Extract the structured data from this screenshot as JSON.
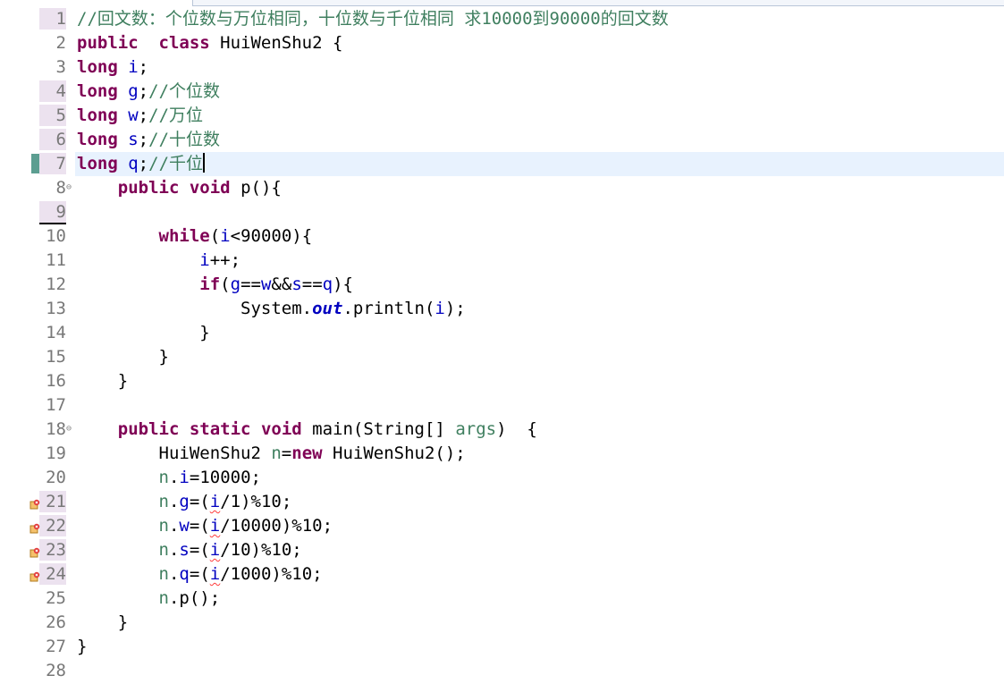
{
  "editor": {
    "lines": [
      {
        "n": "1",
        "parts": [
          [
            "cm",
            "//回文数：个位数与万位相同，十位数与千位相同 求10000到90000的回文数"
          ]
        ]
      },
      {
        "n": "2",
        "parts": [
          [
            "kw",
            "public"
          ],
          [
            "",
            "  "
          ],
          [
            "kw",
            "class"
          ],
          [
            "",
            " HuiWenShu2 {"
          ]
        ]
      },
      {
        "n": "3",
        "parts": [
          [
            "kw",
            "long"
          ],
          [
            "",
            " "
          ],
          [
            "fld",
            "i"
          ],
          [
            "",
            ";"
          ]
        ]
      },
      {
        "n": "4",
        "parts": [
          [
            "kw",
            "long"
          ],
          [
            "",
            " "
          ],
          [
            "fld",
            "g"
          ],
          [
            "",
            ";"
          ],
          [
            "cm",
            "//个位数"
          ]
        ]
      },
      {
        "n": "5",
        "parts": [
          [
            "kw",
            "long"
          ],
          [
            "",
            " "
          ],
          [
            "fld",
            "w"
          ],
          [
            "",
            ";"
          ],
          [
            "cm",
            "//万位"
          ]
        ]
      },
      {
        "n": "6",
        "parts": [
          [
            "kw",
            "long"
          ],
          [
            "",
            " "
          ],
          [
            "fld",
            "s"
          ],
          [
            "",
            ";"
          ],
          [
            "cm",
            "//十位数"
          ]
        ]
      },
      {
        "n": "7",
        "parts": [
          [
            "kw",
            "long"
          ],
          [
            "",
            " "
          ],
          [
            "fld",
            "q"
          ],
          [
            "",
            ";"
          ],
          [
            "cm",
            "//千位"
          ]
        ]
      },
      {
        "n": "8",
        "parts": [
          [
            "",
            "    "
          ],
          [
            "kw",
            "public"
          ],
          [
            "",
            " "
          ],
          [
            "kw",
            "void"
          ],
          [
            "",
            " p(){"
          ]
        ]
      },
      {
        "n": "9",
        "parts": []
      },
      {
        "n": "10",
        "parts": [
          [
            "",
            "        "
          ],
          [
            "kw",
            "while"
          ],
          [
            "",
            "("
          ],
          [
            "fld",
            "i"
          ],
          [
            "",
            "<90000){"
          ]
        ]
      },
      {
        "n": "11",
        "parts": [
          [
            "",
            "            "
          ],
          [
            "fld",
            "i"
          ],
          [
            "",
            "++;"
          ]
        ]
      },
      {
        "n": "12",
        "parts": [
          [
            "",
            "            "
          ],
          [
            "kw",
            "if"
          ],
          [
            "",
            "("
          ],
          [
            "fld",
            "g"
          ],
          [
            "",
            "=="
          ],
          [
            "fld",
            "w"
          ],
          [
            "",
            "&&"
          ],
          [
            "fld",
            "s"
          ],
          [
            "",
            "=="
          ],
          [
            "fld",
            "q"
          ],
          [
            "",
            "){"
          ]
        ]
      },
      {
        "n": "13",
        "parts": [
          [
            "",
            "                System."
          ],
          [
            "sf",
            "out"
          ],
          [
            "",
            ".println("
          ],
          [
            "fld",
            "i"
          ],
          [
            "",
            ");"
          ]
        ]
      },
      {
        "n": "14",
        "parts": [
          [
            "",
            "            }"
          ]
        ]
      },
      {
        "n": "15",
        "parts": [
          [
            "",
            "        }"
          ]
        ]
      },
      {
        "n": "16",
        "parts": [
          [
            "",
            "    }"
          ]
        ]
      },
      {
        "n": "17",
        "parts": []
      },
      {
        "n": "18",
        "parts": [
          [
            "",
            "    "
          ],
          [
            "kw",
            "public"
          ],
          [
            "",
            " "
          ],
          [
            "kw",
            "static"
          ],
          [
            "",
            " "
          ],
          [
            "kw",
            "void"
          ],
          [
            "",
            " main(String[] "
          ],
          [
            "cm",
            "args"
          ],
          [
            "",
            ")  {"
          ]
        ]
      },
      {
        "n": "19",
        "parts": [
          [
            "",
            "        HuiWenShu2 "
          ],
          [
            "cm",
            "n"
          ],
          [
            "",
            "="
          ],
          [
            "kw",
            "new"
          ],
          [
            "",
            " HuiWenShu2();"
          ]
        ]
      },
      {
        "n": "20",
        "parts": [
          [
            "",
            "        "
          ],
          [
            "cm",
            "n"
          ],
          [
            "",
            "."
          ],
          [
            "fld",
            "i"
          ],
          [
            "",
            "=10000;"
          ]
        ]
      },
      {
        "n": "21",
        "parts": [
          [
            "",
            "        "
          ],
          [
            "cm",
            "n"
          ],
          [
            "",
            "."
          ],
          [
            "fld",
            "g"
          ],
          [
            "",
            "=("
          ],
          [
            "fld squig",
            "i"
          ],
          [
            "",
            "/1)%10;"
          ]
        ]
      },
      {
        "n": "22",
        "parts": [
          [
            "",
            "        "
          ],
          [
            "cm",
            "n"
          ],
          [
            "",
            "."
          ],
          [
            "fld",
            "w"
          ],
          [
            "",
            "=("
          ],
          [
            "fld squig",
            "i"
          ],
          [
            "",
            "/10000)%10;"
          ]
        ]
      },
      {
        "n": "23",
        "parts": [
          [
            "",
            "        "
          ],
          [
            "cm",
            "n"
          ],
          [
            "",
            "."
          ],
          [
            "fld",
            "s"
          ],
          [
            "",
            "=("
          ],
          [
            "fld squig",
            "i"
          ],
          [
            "",
            "/10)%10;"
          ]
        ]
      },
      {
        "n": "24",
        "parts": [
          [
            "",
            "        "
          ],
          [
            "cm",
            "n"
          ],
          [
            "",
            "."
          ],
          [
            "fld",
            "q"
          ],
          [
            "",
            "=("
          ],
          [
            "fld squig",
            "i"
          ],
          [
            "",
            "/1000)%10;"
          ]
        ]
      },
      {
        "n": "25",
        "parts": [
          [
            "",
            "        "
          ],
          [
            "cm",
            "n"
          ],
          [
            "",
            ".p();"
          ]
        ]
      },
      {
        "n": "26",
        "parts": [
          [
            "",
            "    }"
          ]
        ]
      },
      {
        "n": "27",
        "parts": [
          [
            "",
            "}"
          ]
        ]
      },
      {
        "n": "28",
        "parts": []
      }
    ],
    "rowbg_lines": [
      "1",
      "4",
      "5",
      "6",
      "7",
      "9",
      "21",
      "22",
      "23",
      "24"
    ],
    "current_line": "7",
    "folded_lines": [
      "8",
      "18"
    ],
    "warning_lines": [
      "21",
      "22",
      "23",
      "24"
    ]
  }
}
